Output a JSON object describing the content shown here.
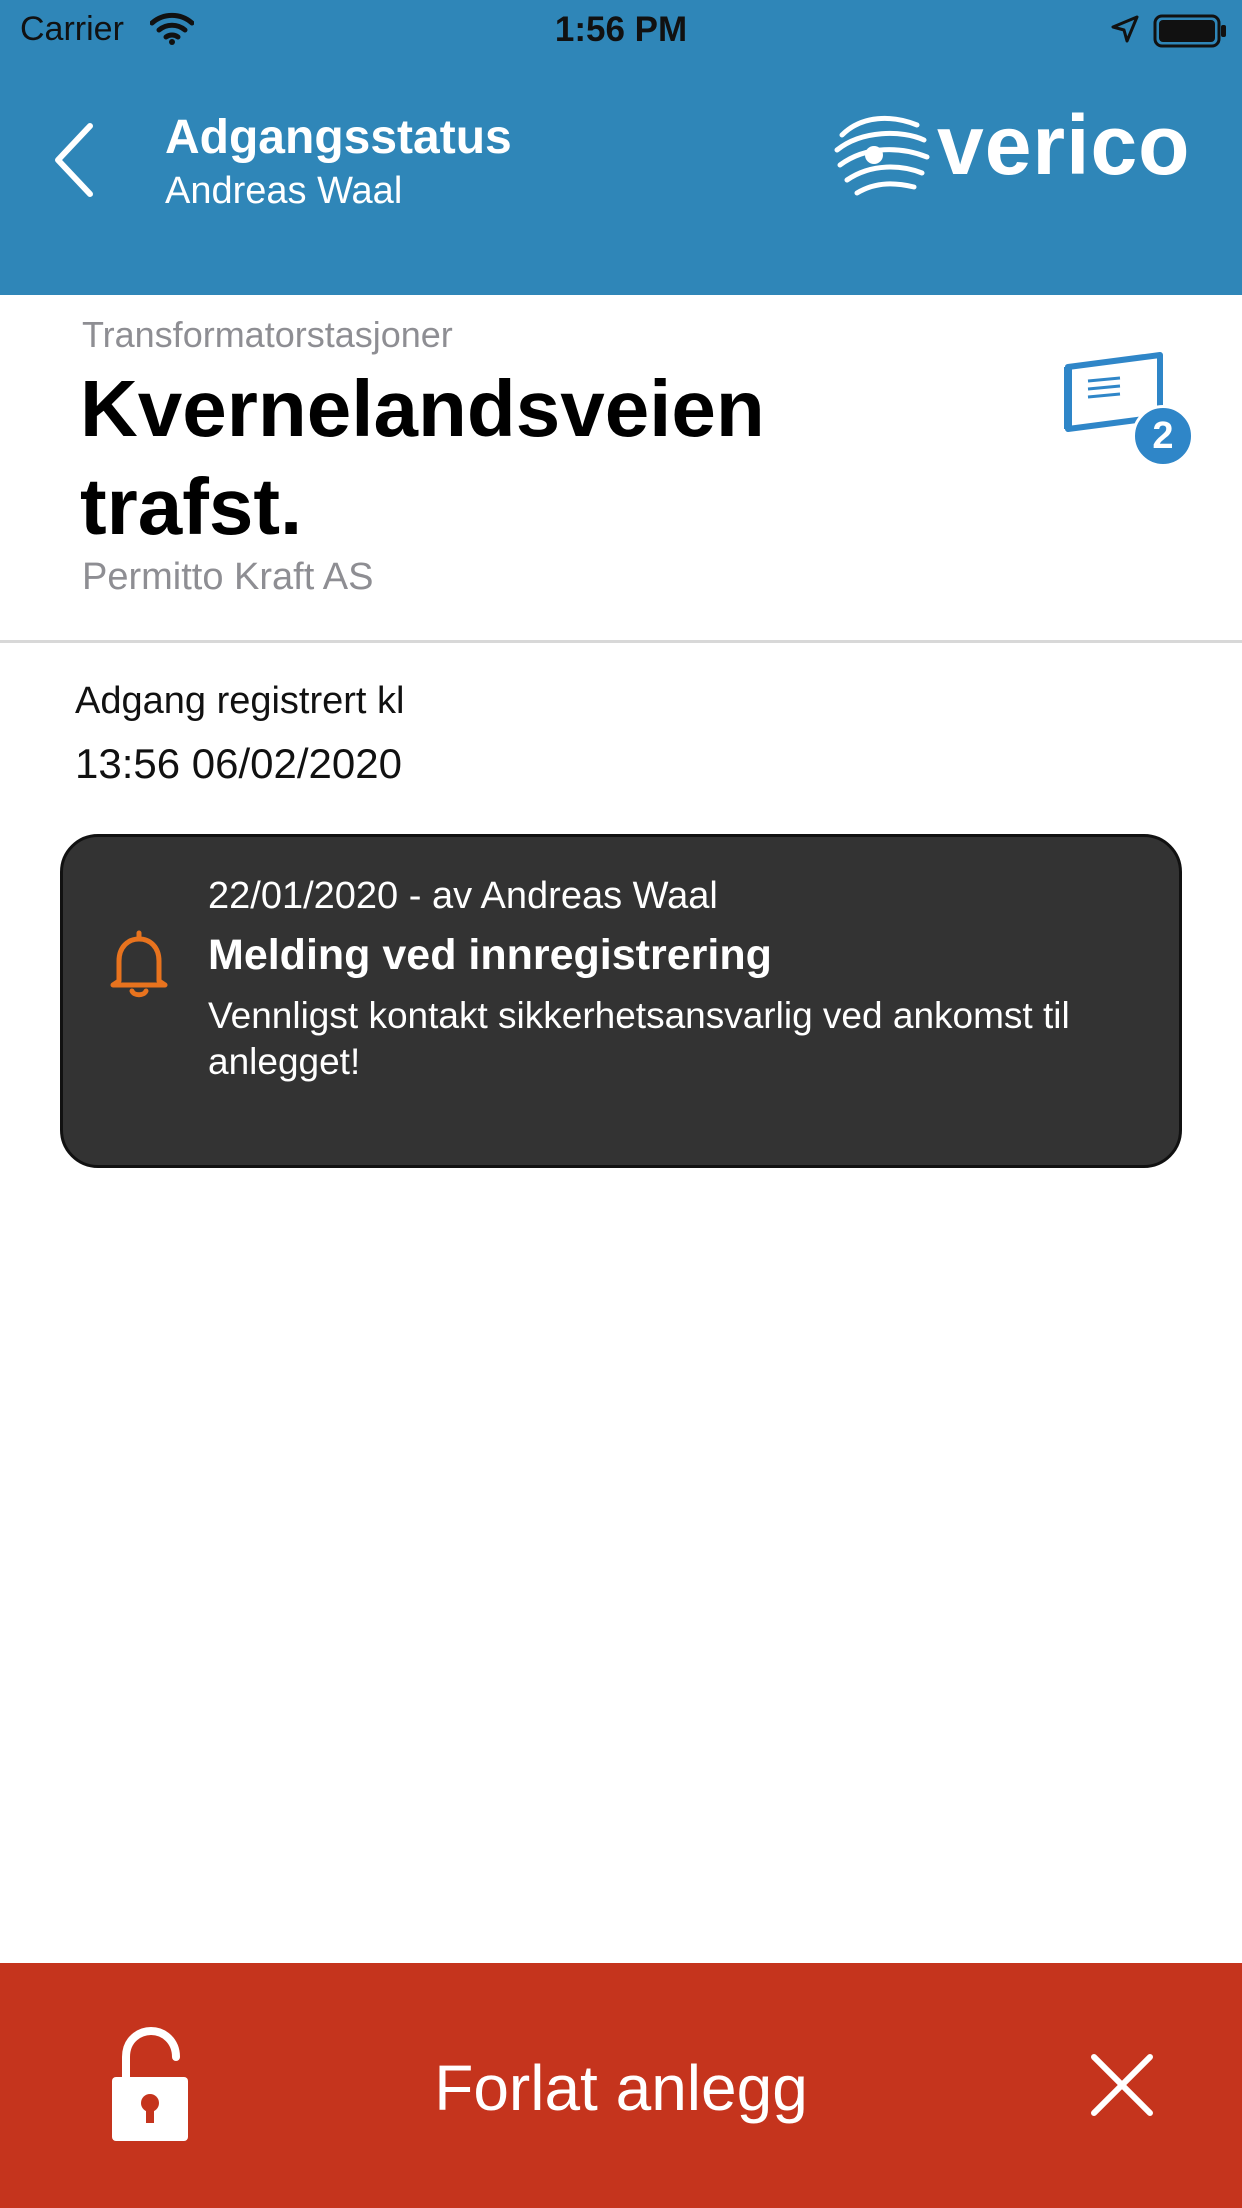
{
  "status_bar": {
    "carrier": "Carrier",
    "time": "1:56 PM"
  },
  "header": {
    "title": "Adgangsstatus",
    "subtitle": "Andreas Waal",
    "logo_text": "verico",
    "color": "#2f86b8"
  },
  "site": {
    "category": "Transformatorstasjoner",
    "name": "Kvernelandsveien trafst.",
    "owner": "Permitto Kraft AS",
    "documents_count": "2"
  },
  "registration": {
    "label": "Adgang registrert kl",
    "time": "13:56 06/02/2020"
  },
  "message": {
    "meta": "22/01/2020 - av Andreas Waal",
    "title": "Melding ved innregistrering",
    "body": "Vennligst kontakt sikkerhetsansvarlig ved ankomst til anlegget!",
    "icon": "bell-icon",
    "icon_color": "#e8731e"
  },
  "bottom_action": {
    "label": "Forlat anlegg",
    "color": "#c5341d",
    "left_icon": "unlock-icon",
    "right_icon": "close-icon"
  }
}
